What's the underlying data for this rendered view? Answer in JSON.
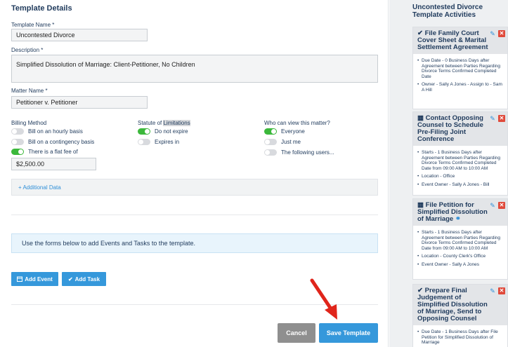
{
  "template_details": {
    "heading": "Template Details",
    "name_label": "Template Name *",
    "name_value": "Uncontested Divorce",
    "description_label": "Description *",
    "description_value": "Simplified Dissolution of Marriage:  Client-Petitioner, No Children",
    "matter_label": "Matter Name *",
    "matter_value": "Petitioner v. Petitioner"
  },
  "billing": {
    "heading": "Billing Method",
    "options": [
      {
        "label": "Bill on an hourly basis",
        "on": false
      },
      {
        "label": "Bill on a contingency basis",
        "on": false
      },
      {
        "label": "There is a flat fee of",
        "on": true
      }
    ],
    "flat_fee": "$2,500.00"
  },
  "statute": {
    "heading_prefix": "Statute of ",
    "heading_highlight": "Limitations",
    "options": [
      {
        "label": "Do not expire",
        "on": true
      },
      {
        "label": "Expires in",
        "on": false
      }
    ]
  },
  "visibility": {
    "heading": "Who can view this matter?",
    "options": [
      {
        "label": "Everyone",
        "on": true
      },
      {
        "label": "Just me",
        "on": false
      },
      {
        "label": "The following users...",
        "on": false
      }
    ]
  },
  "additional_data": "+ Additional Data",
  "info_text": "Use the forms below to add Events and Tasks to the template.",
  "buttons": {
    "add_event": "Add Event",
    "add_task": "Add Task",
    "cancel": "Cancel",
    "save": "Save Template"
  },
  "activities": {
    "heading": "Uncontested Divorce Template Activities",
    "cards": [
      {
        "icon": "check-icon",
        "title": "File Family Court Cover Sheet & Marital Settlement Agreement",
        "items": [
          "Due Date - 0 Business Days after Agreement between Parties Regarding Divorce Terms Confirmed Completed Date",
          "Owner - Sally A Jones - Assign to - Sam A Hill"
        ]
      },
      {
        "icon": "calendar-icon",
        "title": "Contact Opposing Counsel to Schedule Pre-Filing Joint Conference",
        "items": [
          "Starts - 1 Business Days after Agreement between Parties Regarding Divorce Terms Confirmed Completed Date from 09:00 AM to 10:00 AM",
          "Location - Office",
          "Event Owner - Sally A Jones - Bill"
        ]
      },
      {
        "icon": "calendar-icon",
        "title": "File Petition for Simplified Dissolution of Marriage",
        "items": [
          "Starts - 1 Business Days after Agreement between Parties Regarding Divorce Terms Confirmed Completed Date from 09:00 AM to 10:00 AM",
          "Location - County Clerk's Office",
          "Event Owner - Sally A Jones"
        ]
      },
      {
        "icon": "check-icon",
        "title": "Prepare Final Judgement of Simplified Dissolution of Marriage, Send to Opposing Counsel",
        "items": [
          "Due Date - 1 Business Days after File Petition for Simplified Dissolution of Marriage"
        ]
      }
    ]
  },
  "colors": {
    "accent_blue": "#3598db",
    "toggle_on": "#3bb83b",
    "delete_red": "#e04a3b",
    "arrow_red": "#e0251b"
  }
}
